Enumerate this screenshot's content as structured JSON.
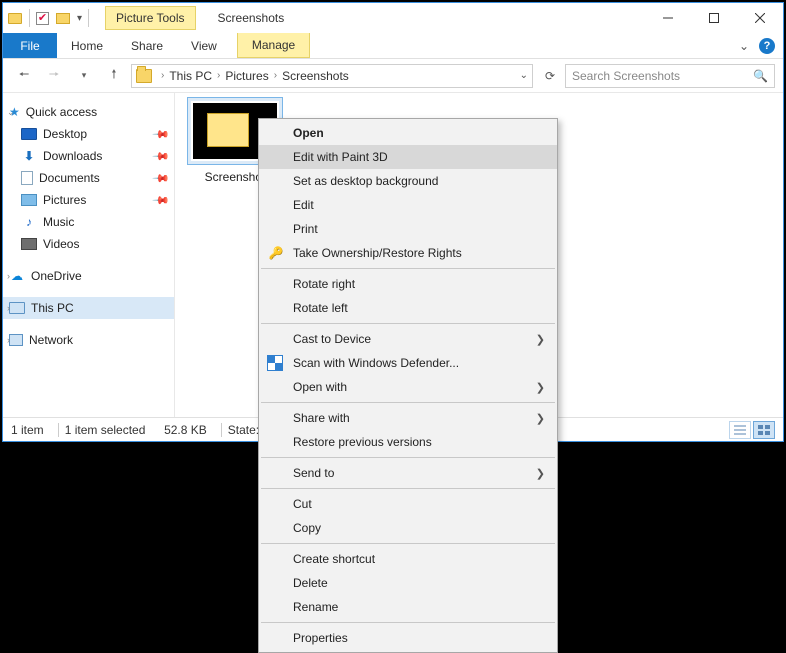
{
  "contextual_tab": "Picture Tools",
  "window_title": "Screenshots",
  "ribbon": {
    "file": "File",
    "home": "Home",
    "share": "Share",
    "view": "View",
    "manage": "Manage"
  },
  "path": {
    "thispc": "This PC",
    "pictures": "Pictures",
    "screenshots": "Screenshots"
  },
  "search_placeholder": "Search Screenshots",
  "sidebar": {
    "quick_access": "Quick access",
    "desktop": "Desktop",
    "downloads": "Downloads",
    "documents": "Documents",
    "pictures": "Pictures",
    "music": "Music",
    "videos": "Videos",
    "onedrive": "OneDrive",
    "thispc": "This PC",
    "network": "Network"
  },
  "file_caption": "Screenshot",
  "status": {
    "items": "1 item",
    "selected": "1 item selected",
    "size": "52.8 KB",
    "state": "State:"
  },
  "ctx": {
    "open": "Open",
    "edit3d": "Edit with Paint 3D",
    "set_bg": "Set as desktop background",
    "edit": "Edit",
    "print": "Print",
    "take_ownership": "Take Ownership/Restore Rights",
    "rotate_right": "Rotate right",
    "rotate_left": "Rotate left",
    "cast": "Cast to Device",
    "defender": "Scan with Windows Defender...",
    "open_with": "Open with",
    "share_with": "Share with",
    "restore": "Restore previous versions",
    "send_to": "Send to",
    "cut": "Cut",
    "copy": "Copy",
    "shortcut": "Create shortcut",
    "delete": "Delete",
    "rename": "Rename",
    "properties": "Properties"
  }
}
